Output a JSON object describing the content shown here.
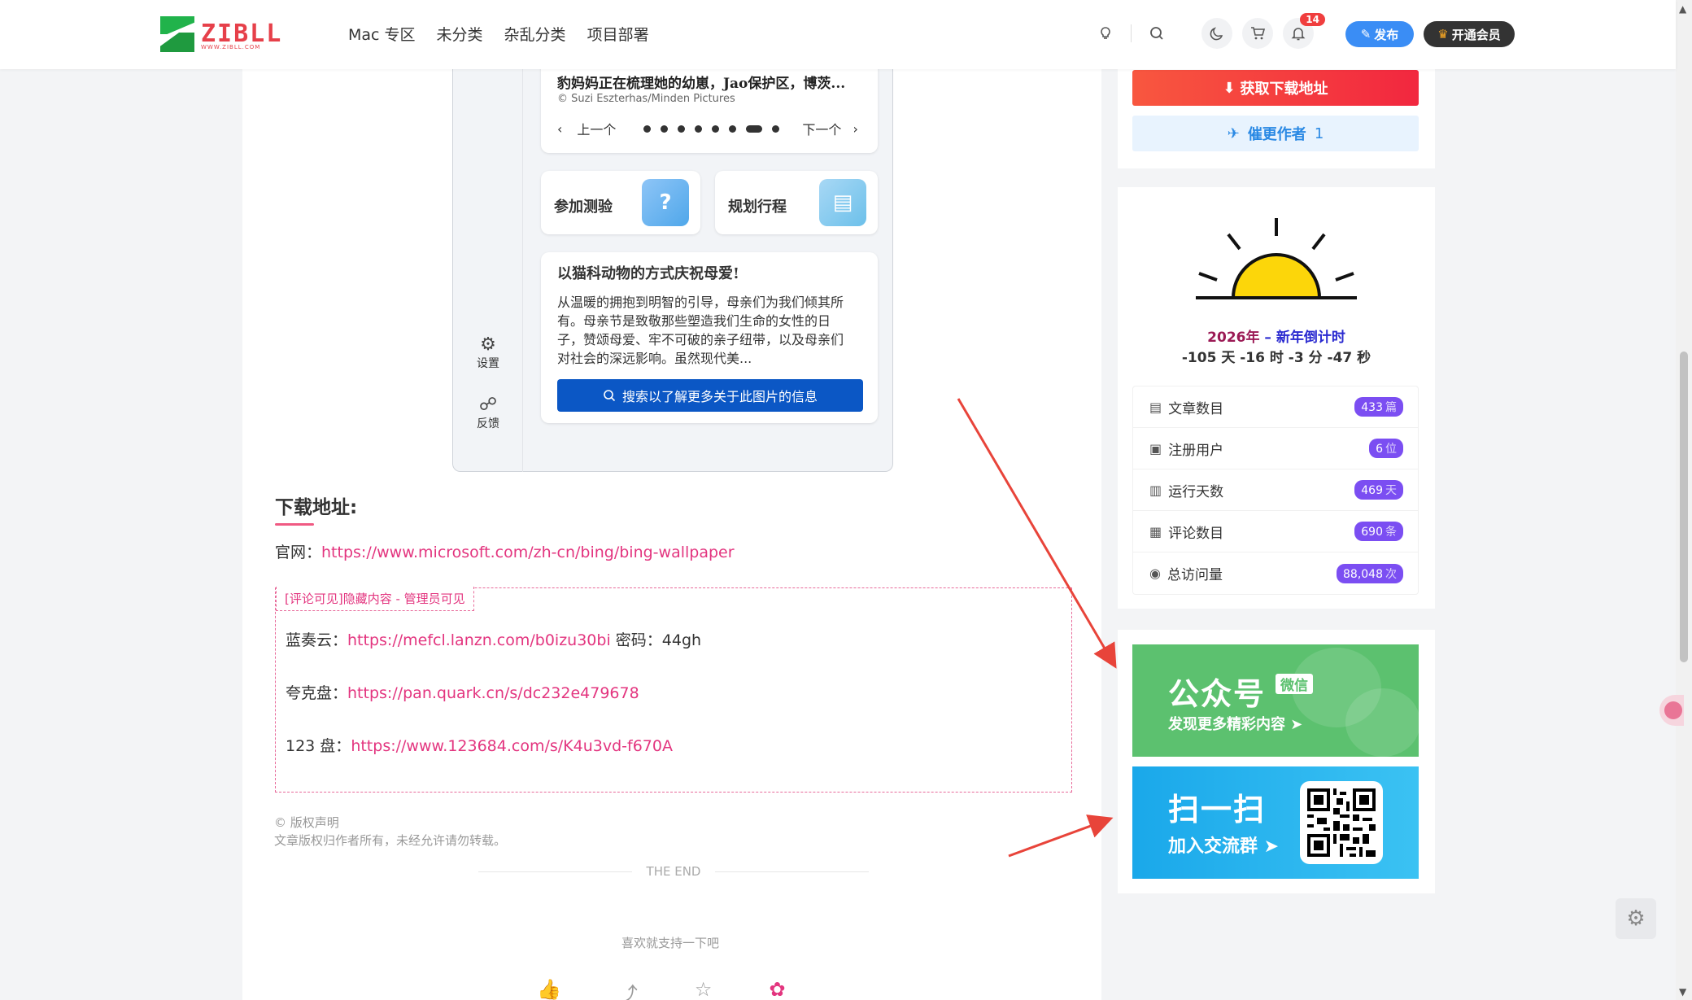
{
  "header": {
    "logo_text": "ZIBLL",
    "logo_sub": "WWW.ZIBLL.COM",
    "nav": [
      "Mac 专区",
      "未分类",
      "杂乱分类",
      "项目部署"
    ],
    "notification_count": "14",
    "publish_label": "发布",
    "vip_label": "开通会员"
  },
  "embedded_app": {
    "caption_title": "豹妈妈正在梳理她的幼崽，Jao保护区，博茨...",
    "caption_credit": "© Suzi Eszterhas/Minden Pictures",
    "prev_label": "上一个",
    "next_label": "下一个",
    "dot_count": 8,
    "active_dot": 7,
    "tile_quiz": "参加测验",
    "tile_trip": "规划行程",
    "article_title": "以猫科动物的方式庆祝母爱!",
    "article_body": "从温暖的拥抱到明智的引导，母亲们为我们倾其所有。母亲节是致敬那些塑造我们生命的女性的日子，赞颂母爱、牢不可破的亲子纽带，以及母亲们对社会的深远影响。虽然现代美...",
    "search_button": "搜索以了解更多关于此图片的信息",
    "side_settings": "设置",
    "side_feedback": "反馈"
  },
  "download": {
    "title": "下载地址:",
    "official_label": "官网：",
    "official_url": "https://www.microsoft.com/zh-cn/bing/bing-wallpaper",
    "hidden_tag": "[评论可见]隐藏内容 - 管理员可见",
    "lanzou_label": "蓝奏云：",
    "lanzou_url": "https://mefcl.lanzn.com/b0izu30bi",
    "lanzou_pw": " 密码：44gh",
    "quark_label": "夸克盘：",
    "quark_url": "https://pan.quark.cn/s/dc232e479678",
    "p123_label": "123 盘：",
    "p123_url": "https://www.123684.com/s/K4u3vd-f670A"
  },
  "footer": {
    "copyright_title": "© 版权声明",
    "copyright_text": "文章版权归作者所有，未经允许请勿转载。",
    "the_end": "THE END",
    "support": "喜欢就支持一下吧"
  },
  "sidebar": {
    "get_download": "获取下载地址",
    "urge_author": "催更作者",
    "urge_count": "1",
    "countdown_year": "2026年",
    "countdown_dash": " – ",
    "countdown_label": "新年倒计时",
    "countdown_time": "-105 天 -16 时 -3 分 -47 秒",
    "stats": [
      {
        "label": "文章数目",
        "value": "433",
        "unit": "篇",
        "icon": "▤"
      },
      {
        "label": "注册用户",
        "value": "6",
        "unit": "位",
        "icon": "▣"
      },
      {
        "label": "运行天数",
        "value": "469",
        "unit": "天",
        "icon": "▥"
      },
      {
        "label": "评论数目",
        "value": "690",
        "unit": "条",
        "icon": "▦"
      },
      {
        "label": "总访问量",
        "value": "88,048",
        "unit": "次",
        "icon": "◉"
      }
    ],
    "wx_big": "公众号",
    "wx_tag": "微信",
    "wx_small": "发现更多精彩内容 ➤",
    "qr_big": "扫一扫",
    "qr_small": "加入交流群 ➤"
  },
  "colors": {
    "accent_pink": "#e3357f",
    "brand_red": "#e6404a",
    "publish_blue": "#3a8df5",
    "stat_purple": "#7b4ef2",
    "wx_green": "#5cc16f",
    "qr_blue": "#1aa8ea"
  }
}
